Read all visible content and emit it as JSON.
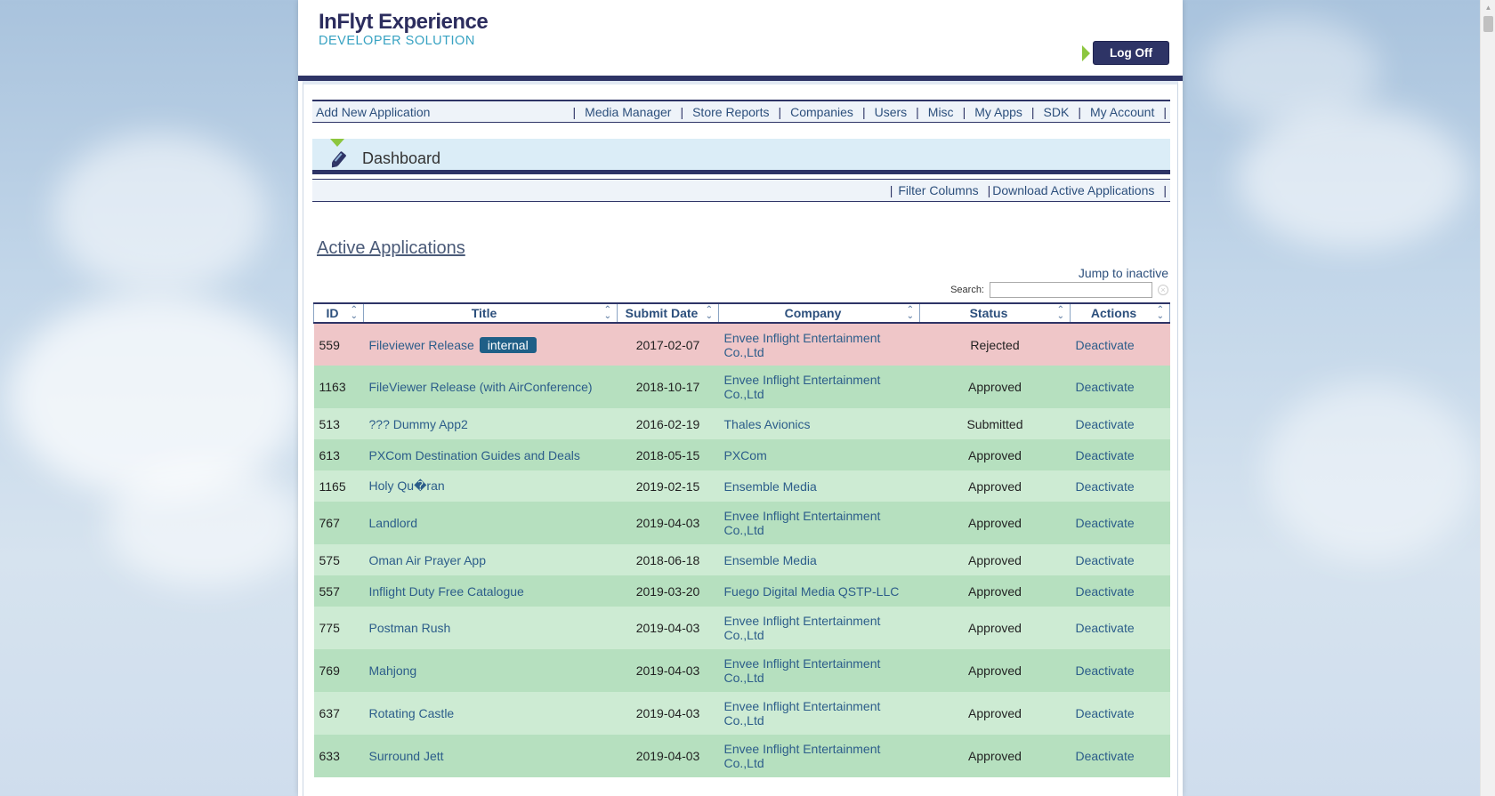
{
  "header": {
    "logo_title": "InFlyt Experience",
    "logo_subtitle": "DEVELOPER SOLUTION",
    "logoff_label": "Log Off"
  },
  "nav": {
    "add_label": "Add New Application",
    "items": [
      "Media Manager",
      "Store Reports",
      "Companies",
      "Users",
      "Misc",
      "My Apps",
      "SDK",
      "My Account"
    ],
    "separator": "|"
  },
  "dashboard": {
    "title": "Dashboard",
    "icon": "pen-icon"
  },
  "subnav": {
    "filter_label": "Filter Columns",
    "download_label": "Download Active Applications"
  },
  "section": {
    "title": "Active Applications",
    "jump_label": "Jump to inactive",
    "search_label": "Search:",
    "search_value": ""
  },
  "table": {
    "columns": [
      "ID",
      "Title",
      "Submit Date",
      "Company",
      "Status",
      "Actions"
    ],
    "rows": [
      {
        "id": "559",
        "title": "Fileviewer Release",
        "badge": "internal",
        "date": "2017-02-07",
        "company": "Envee Inflight Entertainment Co.,Ltd",
        "status": "Rejected",
        "action": "Deactivate",
        "style": "rejected"
      },
      {
        "id": "1163",
        "title": "FileViewer Release (with AirConference)",
        "badge": "",
        "date": "2018-10-17",
        "company": "Envee Inflight Entertainment Co.,Ltd",
        "status": "Approved",
        "action": "Deactivate",
        "style": "alt1"
      },
      {
        "id": "513",
        "title": "??? Dummy App2",
        "badge": "",
        "date": "2016-02-19",
        "company": "Thales Avionics",
        "status": "Submitted",
        "action": "Deactivate",
        "style": "alt2"
      },
      {
        "id": "613",
        "title": "PXCom Destination Guides and Deals",
        "badge": "",
        "date": "2018-05-15",
        "company": "PXCom",
        "status": "Approved",
        "action": "Deactivate",
        "style": "alt1"
      },
      {
        "id": "1165",
        "title": "Holy Qu�ran",
        "badge": "",
        "date": "2019-02-15",
        "company": "Ensemble Media",
        "status": "Approved",
        "action": "Deactivate",
        "style": "alt2"
      },
      {
        "id": "767",
        "title": "Landlord",
        "badge": "",
        "date": "2019-04-03",
        "company": "Envee Inflight Entertainment Co.,Ltd",
        "status": "Approved",
        "action": "Deactivate",
        "style": "alt1"
      },
      {
        "id": "575",
        "title": "Oman Air Prayer App",
        "badge": "",
        "date": "2018-06-18",
        "company": "Ensemble Media",
        "status": "Approved",
        "action": "Deactivate",
        "style": "alt2"
      },
      {
        "id": "557",
        "title": "Inflight Duty Free Catalogue",
        "badge": "",
        "date": "2019-03-20",
        "company": "Fuego Digital Media QSTP-LLC",
        "status": "Approved",
        "action": "Deactivate",
        "style": "alt1"
      },
      {
        "id": "775",
        "title": "Postman Rush",
        "badge": "",
        "date": "2019-04-03",
        "company": "Envee Inflight Entertainment Co.,Ltd",
        "status": "Approved",
        "action": "Deactivate",
        "style": "alt2"
      },
      {
        "id": "769",
        "title": "Mahjong",
        "badge": "",
        "date": "2019-04-03",
        "company": "Envee Inflight Entertainment Co.,Ltd",
        "status": "Approved",
        "action": "Deactivate",
        "style": "alt1"
      },
      {
        "id": "637",
        "title": "Rotating Castle",
        "badge": "",
        "date": "2019-04-03",
        "company": "Envee Inflight Entertainment Co.,Ltd",
        "status": "Approved",
        "action": "Deactivate",
        "style": "alt2"
      },
      {
        "id": "633",
        "title": "Surround Jett",
        "badge": "",
        "date": "2019-04-03",
        "company": "Envee Inflight Entertainment Co.,Ltd",
        "status": "Approved",
        "action": "Deactivate",
        "style": "alt1"
      }
    ]
  },
  "colors": {
    "navy": "#2e3466",
    "accent_green": "#8cc63e",
    "link": "#2c5d8a",
    "rejected_row": "#efc6c8",
    "approved_row_a": "#b6e0bf",
    "approved_row_b": "#cdebd3"
  }
}
